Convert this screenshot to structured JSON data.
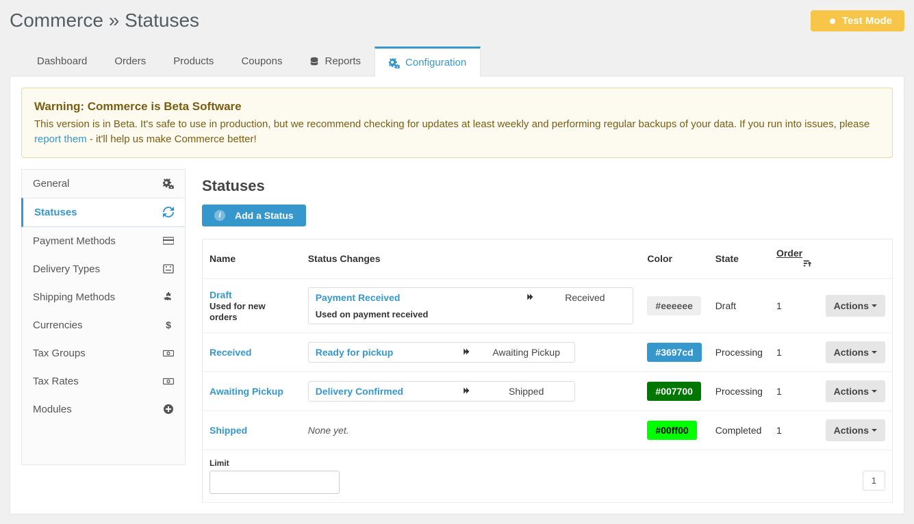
{
  "breadcrumb": {
    "root": "Commerce",
    "sep": "»",
    "current": "Statuses"
  },
  "badge": {
    "label": "Test Mode"
  },
  "tabs": [
    {
      "label": "Dashboard"
    },
    {
      "label": "Orders"
    },
    {
      "label": "Products"
    },
    {
      "label": "Coupons"
    },
    {
      "label": "Reports",
      "icon": "database"
    },
    {
      "label": "Configuration",
      "icon": "gears",
      "active": true
    }
  ],
  "alert": {
    "title": "Warning: Commerce is Beta Software",
    "body_a": "This version is in Beta. It's safe to use in production, but we recommend checking for updates at least weekly and performing regular backups of your data. If you run into issues, please ",
    "link": "report them",
    "body_b": " - it'll help us make Commerce better!"
  },
  "sidebar": [
    {
      "label": "General",
      "icon": "gears"
    },
    {
      "label": "Statuses",
      "icon": "refresh",
      "active": true
    },
    {
      "label": "Payment Methods",
      "icon": "card"
    },
    {
      "label": "Delivery Types",
      "icon": "box"
    },
    {
      "label": "Shipping Methods",
      "icon": "ship"
    },
    {
      "label": "Currencies",
      "icon": "dollar"
    },
    {
      "label": "Tax Groups",
      "icon": "money"
    },
    {
      "label": "Tax Rates",
      "icon": "money"
    },
    {
      "label": "Modules",
      "icon": "plus-circle"
    }
  ],
  "page": {
    "title": "Statuses",
    "add_button": "Add a Status",
    "headers": {
      "name": "Name",
      "status_changes": "Status Changes",
      "color": "Color",
      "state": "State",
      "order": "Order"
    },
    "actions_label": "Actions",
    "limit_label": "Limit",
    "none_yet": "None yet.",
    "pager": {
      "current": "1"
    }
  },
  "rows": [
    {
      "name": "Draft",
      "sub": "Used for new orders",
      "sc": {
        "name": "Payment Received",
        "sub": "Used on payment received",
        "dest": "Received"
      },
      "color": "#eeeeee",
      "color_text": "#555",
      "state": "Draft",
      "order": "1"
    },
    {
      "name": "Received",
      "sc": {
        "name": "Ready for pickup",
        "dest": "Awaiting Pickup"
      },
      "color": "#3697cd",
      "color_text": "#fff",
      "state": "Processing",
      "order": "1"
    },
    {
      "name": "Awaiting Pickup",
      "sc": {
        "name": "Delivery Confirmed",
        "dest": "Shipped"
      },
      "color": "#007700",
      "color_text": "#fff",
      "state": "Processing",
      "order": "1"
    },
    {
      "name": "Shipped",
      "sc": null,
      "color": "#00ff00",
      "color_text": "#000",
      "state": "Completed",
      "order": "1"
    }
  ]
}
